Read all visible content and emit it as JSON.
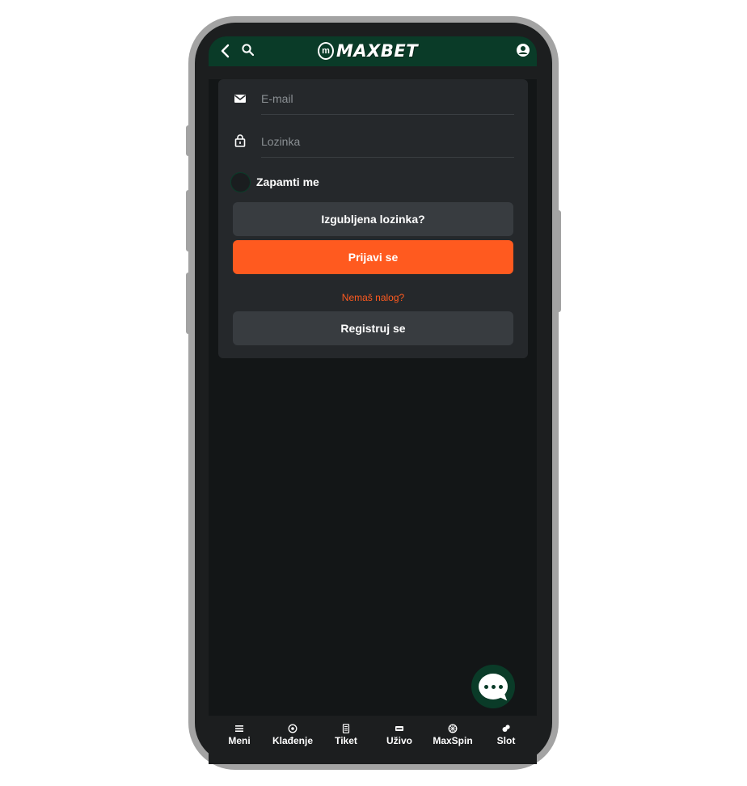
{
  "header": {
    "logo_text": "MAXBET",
    "logo_mark": "m",
    "icons": [
      "back-icon",
      "search-icon",
      "user-icon"
    ]
  },
  "login": {
    "email_placeholder": "E-mail",
    "password_placeholder": "Lozinka",
    "remember_label": "Zapamti me",
    "forgot_label": "Izgubljena lozinka?",
    "login_label": "Prijavi se",
    "no_account_text": "Nemaš nalog?",
    "register_label": "Registruj se"
  },
  "nav": {
    "items": [
      {
        "label": "Meni",
        "icon": "menu-icon"
      },
      {
        "label": "Klađenje",
        "icon": "soccer-ball-icon"
      },
      {
        "label": "Tiket",
        "icon": "ticket-icon"
      },
      {
        "label": "Uživo",
        "icon": "live-icon"
      },
      {
        "label": "MaxSpin",
        "icon": "spin-icon"
      },
      {
        "label": "Slot",
        "icon": "slot-icon"
      }
    ]
  },
  "colors": {
    "brand_green": "#0a3b28",
    "accent_orange": "#ff5a1f",
    "card_bg": "#25282b",
    "screen_bg": "#131617"
  }
}
